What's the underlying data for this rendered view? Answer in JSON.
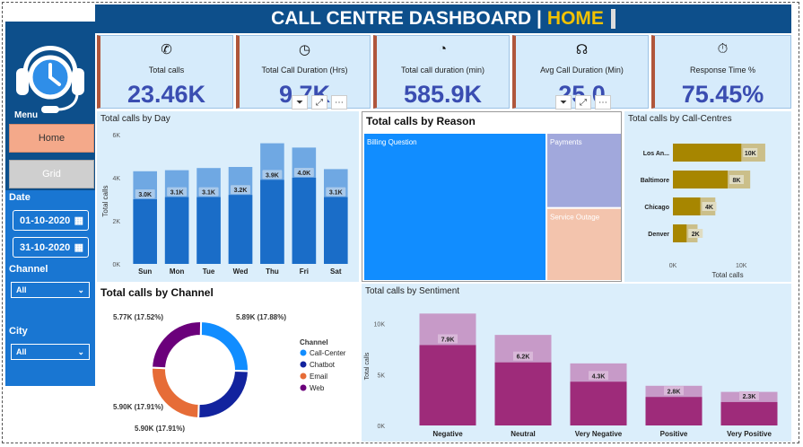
{
  "header": {
    "title": "CALL CENTRE DASHBOARD |",
    "page": "HOME"
  },
  "sidebar": {
    "menu_label": "Menu",
    "home_label": "Home",
    "grid_label": "Grid",
    "date_label": "Date",
    "date_from": "01-10-2020",
    "date_to": "31-10-2020",
    "channel_label": "Channel",
    "channel_value": "All",
    "city_label": "City",
    "city_value": "All"
  },
  "kpis": [
    {
      "label": "Total calls",
      "value": "23.46K",
      "icon": "phone-icon"
    },
    {
      "label": "Total Call Duration (Hrs)",
      "value": "9.7K",
      "icon": "24h-clock-icon"
    },
    {
      "label": "Total call duration (min)",
      "value": "585.9K",
      "icon": "all-hours-icon"
    },
    {
      "label": "Avg Call Duration (Min)",
      "value": "25.0",
      "icon": "headset-icon"
    },
    {
      "label": "Response Time %",
      "value": "75.45%",
      "icon": "stopwatch-icon"
    }
  ],
  "colors": {
    "header": "#0d4f8b",
    "sidebar": "#1976d2",
    "accent": "#f2c200",
    "kpi_value": "#3a4db1",
    "panel": "#dbeefb"
  },
  "chart_data": [
    {
      "type": "bar",
      "title": "Total calls by Day",
      "ylabel": "Total calls",
      "xlabel": "",
      "categories": [
        "Sun",
        "Mon",
        "Tue",
        "Wed",
        "Thu",
        "Fri",
        "Sat"
      ],
      "values": [
        3.0,
        3.1,
        3.1,
        3.2,
        3.9,
        4.0,
        3.1
      ],
      "value_labels": [
        "3.0K",
        "3.1K",
        "3.1K",
        "3.2K",
        "3.9K",
        "4.0K",
        "3.1K"
      ],
      "overlay_values": [
        4.3,
        4.35,
        4.45,
        4.5,
        5.6,
        5.4,
        4.4
      ],
      "yticks": [
        "0K",
        "2K",
        "4K",
        "6K"
      ],
      "ylim": [
        0,
        6
      ]
    },
    {
      "type": "treemap",
      "title": "Total calls by Reason",
      "categories": [
        "Billing Question",
        "Payments",
        "Service Outage"
      ],
      "values": [
        16.6,
        3.5,
        3.4
      ]
    },
    {
      "type": "bar",
      "orientation": "horizontal",
      "title": "Total calls by Call-Centres",
      "xlabel": "Total calls",
      "categories": [
        "Los An...",
        "Baltimore",
        "Chicago",
        "Denver"
      ],
      "values": [
        10,
        8,
        4,
        2
      ],
      "value_labels": [
        "10K",
        "8K",
        "4K",
        "2K"
      ],
      "overlay_values": [
        13.5,
        11.3,
        6.2,
        3.6
      ],
      "xticks": [
        "0K",
        "10K"
      ],
      "xlim": [
        0,
        16
      ]
    },
    {
      "type": "pie",
      "title": "Total calls by Channel",
      "legend_title": "Channel",
      "categories": [
        "Call-Center",
        "Chatbot",
        "Email",
        "Web"
      ],
      "values": [
        5.89,
        5.9,
        5.9,
        5.77
      ],
      "percents": [
        "17.88%",
        "17.91%",
        "17.91%",
        "17.52%"
      ],
      "value_labels": [
        "5.89K (17.88%)",
        "5.90K (17.91%)",
        "5.90K (17.91%)",
        "5.77K (17.52%)"
      ],
      "colors": [
        "#118dff",
        "#12239e",
        "#e66c37",
        "#6b007b"
      ]
    },
    {
      "type": "bar",
      "title": "Total calls by Sentiment",
      "ylabel": "Total calls",
      "categories": [
        "Negative",
        "Neutral",
        "Very Negative",
        "Positive",
        "Very Positive"
      ],
      "values": [
        7.9,
        6.2,
        4.3,
        2.8,
        2.3
      ],
      "value_labels": [
        "7.9K",
        "6.2K",
        "4.3K",
        "2.8K",
        "2.3K"
      ],
      "overlay_values": [
        11.0,
        8.9,
        6.1,
        3.9,
        3.3
      ],
      "yticks": [
        "0K",
        "5K",
        "10K"
      ],
      "ylim": [
        0,
        12
      ]
    }
  ]
}
